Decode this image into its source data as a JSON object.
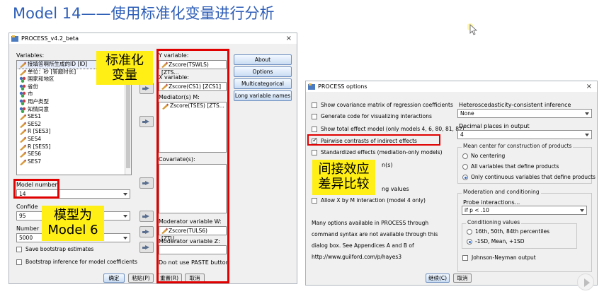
{
  "slide": {
    "title": "Model 14——使用标准化变量进行分析"
  },
  "process_dialog": {
    "title": "PROCESS_v4.2_beta",
    "close": "×",
    "variables_label": "Variables:",
    "variables": [
      {
        "label": "接填答啊所生成的ID [ID]",
        "icon": "scale-icon",
        "selected": true
      },
      {
        "label": "单位：秒 [答题时长]",
        "icon": "scale-icon"
      },
      {
        "label": "国家和地区",
        "icon": "nominal-icon"
      },
      {
        "label": "省份",
        "icon": "nominal-icon"
      },
      {
        "label": "市",
        "icon": "nominal-icon"
      },
      {
        "label": "用户类型",
        "icon": "nominal-icon"
      },
      {
        "label": "知情同意",
        "icon": "nominal-icon"
      },
      {
        "label": "SES1",
        "icon": "scale-icon"
      },
      {
        "label": "SES2",
        "icon": "scale-icon"
      },
      {
        "label": "R [SES3]",
        "icon": "scale-icon"
      },
      {
        "label": "SES4",
        "icon": "scale-icon"
      },
      {
        "label": "R [SES5]",
        "icon": "scale-icon"
      },
      {
        "label": "SES6",
        "icon": "scale-icon"
      },
      {
        "label": "SES7",
        "icon": "scale-icon"
      }
    ],
    "y_label": "Y variable:",
    "y_value": "Zscore(TSWLS) [ZTS...",
    "x_label": "X variable:",
    "x_value": "Zscore(CS1) [ZCS1]",
    "mediator_label": "Mediator(s) M:",
    "mediator_value": "Zscore(TSES) [ZTS...",
    "covariate_label": "Covariate(s):",
    "moderator_w_label": "Moderator variable W:",
    "moderator_w_value": "Zscore(TULS6) [ZTU...",
    "moderator_z_label": "Moderator variable Z:",
    "model_number_label": "Model number:",
    "model_number_value": "14",
    "confidence_label": "Confide",
    "confidence_value": "95",
    "number_label": "Number",
    "number_value": "5000",
    "save_bootstrap": "Save bootstrap estimates",
    "bootstrap_inference": "Bootstrap inference for model coefficients",
    "paste_note": "Do not use PASTE button",
    "side_buttons": [
      "About",
      "Options",
      "Multicategorical",
      "Long variable names"
    ],
    "footer_buttons": [
      "确定",
      "粘贴(P)",
      "重置(R)",
      "取消"
    ]
  },
  "options_dialog": {
    "title": "PROCESS options",
    "close": "×",
    "checks": [
      {
        "label": "Show covariance matrix of regression coefficients",
        "checked": false
      },
      {
        "label": "Generate code for visualizing interactions",
        "checked": false
      },
      {
        "label": "Show total effect model (only models 4, 6, 80, 81, 82)",
        "checked": false
      },
      {
        "label": "Pairwise contrasts of indirect effects",
        "checked": true
      },
      {
        "label": "Standardized effects (mediation-only models)",
        "checked": false
      }
    ],
    "partial_1": "n(s)",
    "partial_2": "ng values",
    "allow_xm": "Allow X by M interaction (model 4 only)",
    "note": "Many options available in PROCESS through command syntax are not available through this dialog box.  See Appendices A and B of http://www.guilford.com/p/hayes3",
    "hc_label": "Heteroscedasticity-consistent inference",
    "hc_value": "None",
    "decimal_label": "Decimal places in output",
    "decimal_value": "4",
    "mean_center_title": "Mean center for construction of products",
    "mean_center_options": [
      {
        "label": "No centering",
        "checked": false
      },
      {
        "label": "All variables that define products",
        "checked": false
      },
      {
        "label": "Only continuous variables that define products",
        "checked": true
      }
    ],
    "moderation_title": "Moderation and conditioning",
    "probe_label": "Probe interactions...",
    "probe_value": "if p < .10",
    "conditioning_title": "Conditioning values",
    "conditioning_options": [
      {
        "label": "16th, 50th, 84th percentiles",
        "checked": false
      },
      {
        "label": "-1SD, Mean, +1SD",
        "checked": true
      }
    ],
    "johnson_neyman": "Johnson-Neyman output",
    "footer_buttons": [
      "继续(C)",
      "取消"
    ]
  },
  "callouts": {
    "standardize": "标准化\n变量",
    "model": "模型为\nModel 6",
    "pairwise": "间接效应\n差异比较"
  },
  "colors": {
    "title_blue": "#2e5eb7",
    "highlight_red": "#e00000",
    "callout_yellow": "#ffef14"
  }
}
